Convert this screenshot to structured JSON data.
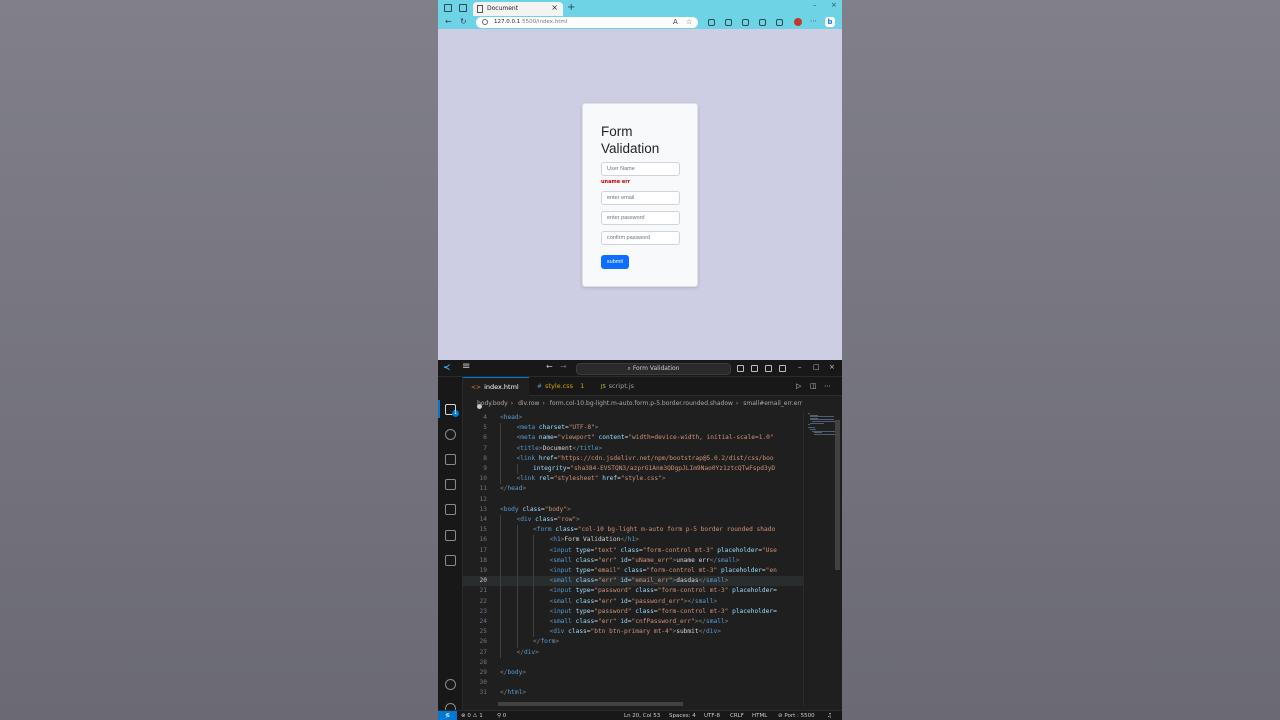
{
  "browser": {
    "tab_title": "Document",
    "url_host": "127.0.0.1",
    "url_path": ":5500/index.html",
    "form": {
      "title": "Form Validation",
      "username_placeholder": "User Name",
      "username_error": "uname err",
      "email_placeholder": "enter email",
      "password_placeholder": "enter password",
      "confirm_placeholder": "confirm password",
      "submit_label": "submit"
    },
    "colors": {
      "tabbar": "#6fd3e6",
      "page_bg": "#cdcde4",
      "button": "#0d6efd",
      "error": "#cc0000"
    }
  },
  "vscode": {
    "command_center": "Form Validation",
    "tabs": [
      {
        "label": "index.html",
        "icon": "<>",
        "modified": true
      },
      {
        "label": "style.css",
        "icon": "#",
        "problems": "1"
      },
      {
        "label": "script.js",
        "icon": "JS"
      }
    ],
    "breadcrumb": [
      "body.body",
      "div.row",
      "form.col-10.bg-light.m-auto.form.p-5.border.rounded.shadow",
      "small#email_err.err"
    ],
    "activity_badge": "1",
    "status": {
      "errors": "0",
      "warnings": "1",
      "ports": "0",
      "position": "Ln 20, Col 53",
      "spaces": "Spaces: 4",
      "encoding": "UTF-8",
      "eol": "CRLF",
      "language": "HTML",
      "port": "Port : 5500"
    },
    "current_line": 20,
    "lines": [
      {
        "n": "4",
        "indent": 0,
        "tokens": [
          [
            "p",
            "<"
          ],
          [
            "t",
            "head"
          ],
          [
            "p",
            ">"
          ]
        ]
      },
      {
        "n": "5",
        "indent": 1,
        "tokens": [
          [
            "p",
            "<"
          ],
          [
            "t",
            "meta "
          ],
          [
            "a",
            "charset"
          ],
          [
            "x",
            "="
          ],
          [
            "s",
            "\"UTF-8\""
          ],
          [
            "p",
            ">"
          ]
        ]
      },
      {
        "n": "6",
        "indent": 1,
        "tokens": [
          [
            "p",
            "<"
          ],
          [
            "t",
            "meta "
          ],
          [
            "a",
            "name"
          ],
          [
            "x",
            "="
          ],
          [
            "s",
            "\"viewport\" "
          ],
          [
            "a",
            "content"
          ],
          [
            "x",
            "="
          ],
          [
            "s",
            "\"width=device-width, initial-scale=1.0\""
          ]
        ]
      },
      {
        "n": "7",
        "indent": 1,
        "tokens": [
          [
            "p",
            "<"
          ],
          [
            "t",
            "title"
          ],
          [
            "p",
            ">"
          ],
          [
            "x",
            "Document"
          ],
          [
            "p",
            "</"
          ],
          [
            "t",
            "title"
          ],
          [
            "p",
            ">"
          ]
        ]
      },
      {
        "n": "8",
        "indent": 1,
        "tokens": [
          [
            "p",
            "<"
          ],
          [
            "t",
            "link "
          ],
          [
            "a",
            "href"
          ],
          [
            "x",
            "="
          ],
          [
            "s",
            "\"https://cdn.jsdelivr.net/npm/bootstrap@5.0.2/dist/css/boo"
          ]
        ]
      },
      {
        "n": "9",
        "indent": 2,
        "tokens": [
          [
            "a",
            "integrity"
          ],
          [
            "x",
            "="
          ],
          [
            "s",
            "\"sha384-EVSTQN3/azprG1Anm3QDgpJLIm9Nao0Yz1ztcQTwFspd3yD"
          ]
        ]
      },
      {
        "n": "10",
        "indent": 1,
        "tokens": [
          [
            "p",
            "<"
          ],
          [
            "t",
            "link "
          ],
          [
            "a",
            "rel"
          ],
          [
            "x",
            "="
          ],
          [
            "s",
            "\"stylesheet\" "
          ],
          [
            "a",
            "href"
          ],
          [
            "x",
            "="
          ],
          [
            "s",
            "\"style.css\""
          ],
          [
            "p",
            ">"
          ]
        ]
      },
      {
        "n": "11",
        "indent": 0,
        "tokens": [
          [
            "p",
            "</"
          ],
          [
            "t",
            "head"
          ],
          [
            "p",
            ">"
          ]
        ]
      },
      {
        "n": "12",
        "indent": 0,
        "tokens": []
      },
      {
        "n": "13",
        "indent": 0,
        "tokens": [
          [
            "p",
            "<"
          ],
          [
            "t",
            "body "
          ],
          [
            "a",
            "class"
          ],
          [
            "x",
            "="
          ],
          [
            "s",
            "\"body\""
          ],
          [
            "p",
            ">"
          ]
        ]
      },
      {
        "n": "14",
        "indent": 1,
        "tokens": [
          [
            "p",
            "<"
          ],
          [
            "t",
            "div "
          ],
          [
            "a",
            "class"
          ],
          [
            "x",
            "="
          ],
          [
            "s",
            "\"row\""
          ],
          [
            "p",
            ">"
          ]
        ]
      },
      {
        "n": "15",
        "indent": 2,
        "tokens": [
          [
            "p",
            "<"
          ],
          [
            "t",
            "form "
          ],
          [
            "a",
            "class"
          ],
          [
            "x",
            "="
          ],
          [
            "s",
            "\"col-10 bg-light m-auto form p-5 border rounded shado"
          ]
        ]
      },
      {
        "n": "16",
        "indent": 3,
        "tokens": [
          [
            "p",
            "<"
          ],
          [
            "t",
            "h1"
          ],
          [
            "p",
            ">"
          ],
          [
            "x",
            "Form Validation"
          ],
          [
            "p",
            "</"
          ],
          [
            "t",
            "h1"
          ],
          [
            "p",
            ">"
          ]
        ]
      },
      {
        "n": "17",
        "indent": 3,
        "tokens": [
          [
            "p",
            "<"
          ],
          [
            "t",
            "input "
          ],
          [
            "a",
            "type"
          ],
          [
            "x",
            "="
          ],
          [
            "s",
            "\"text\" "
          ],
          [
            "a",
            "class"
          ],
          [
            "x",
            "="
          ],
          [
            "s",
            "\"form-control mt-3\" "
          ],
          [
            "a",
            "placeholder"
          ],
          [
            "x",
            "="
          ],
          [
            "s",
            "\"Use"
          ]
        ]
      },
      {
        "n": "18",
        "indent": 3,
        "tokens": [
          [
            "p",
            "<"
          ],
          [
            "t",
            "small "
          ],
          [
            "a",
            "class"
          ],
          [
            "x",
            "="
          ],
          [
            "s",
            "\"err\" "
          ],
          [
            "a",
            "id"
          ],
          [
            "x",
            "="
          ],
          [
            "s",
            "\"uName_err\""
          ],
          [
            "p",
            ">"
          ],
          [
            "x",
            "uname err"
          ],
          [
            "p",
            "</"
          ],
          [
            "t",
            "small"
          ],
          [
            "p",
            ">"
          ]
        ]
      },
      {
        "n": "19",
        "indent": 3,
        "tokens": [
          [
            "p",
            "<"
          ],
          [
            "t",
            "input "
          ],
          [
            "a",
            "type"
          ],
          [
            "x",
            "="
          ],
          [
            "s",
            "\"email\" "
          ],
          [
            "a",
            "class"
          ],
          [
            "x",
            "="
          ],
          [
            "s",
            "\"form-control mt-3\" "
          ],
          [
            "a",
            "placeholder"
          ],
          [
            "x",
            "="
          ],
          [
            "s",
            "\"en"
          ]
        ]
      },
      {
        "n": "20",
        "indent": 3,
        "tokens": [
          [
            "p",
            "<"
          ],
          [
            "t",
            "small "
          ],
          [
            "a",
            "class"
          ],
          [
            "x",
            "="
          ],
          [
            "s",
            "\"err\" "
          ],
          [
            "a",
            "id"
          ],
          [
            "x",
            "="
          ],
          [
            "s",
            "\"email_err\""
          ],
          [
            "p",
            ">"
          ],
          [
            "x",
            "dasdas"
          ],
          [
            "p",
            "</"
          ],
          [
            "t",
            "small"
          ],
          [
            "p",
            ">"
          ]
        ]
      },
      {
        "n": "21",
        "indent": 3,
        "tokens": [
          [
            "p",
            "<"
          ],
          [
            "t",
            "input "
          ],
          [
            "a",
            "type"
          ],
          [
            "x",
            "="
          ],
          [
            "s",
            "\"password\" "
          ],
          [
            "a",
            "class"
          ],
          [
            "x",
            "="
          ],
          [
            "s",
            "\"form-control mt-3\" "
          ],
          [
            "a",
            "placeholder"
          ],
          [
            "x",
            "="
          ]
        ]
      },
      {
        "n": "22",
        "indent": 3,
        "tokens": [
          [
            "p",
            "<"
          ],
          [
            "t",
            "small "
          ],
          [
            "a",
            "class"
          ],
          [
            "x",
            "="
          ],
          [
            "s",
            "\"err\" "
          ],
          [
            "a",
            "id"
          ],
          [
            "x",
            "="
          ],
          [
            "s",
            "\"password_err\""
          ],
          [
            "p",
            "></"
          ],
          [
            "t",
            "small"
          ],
          [
            "p",
            ">"
          ]
        ]
      },
      {
        "n": "23",
        "indent": 3,
        "tokens": [
          [
            "p",
            "<"
          ],
          [
            "t",
            "input "
          ],
          [
            "a",
            "type"
          ],
          [
            "x",
            "="
          ],
          [
            "s",
            "\"password\" "
          ],
          [
            "a",
            "class"
          ],
          [
            "x",
            "="
          ],
          [
            "s",
            "\"form-control mt-3\" "
          ],
          [
            "a",
            "placeholder"
          ],
          [
            "x",
            "="
          ]
        ]
      },
      {
        "n": "24",
        "indent": 3,
        "tokens": [
          [
            "p",
            "<"
          ],
          [
            "t",
            "small "
          ],
          [
            "a",
            "class"
          ],
          [
            "x",
            "="
          ],
          [
            "s",
            "\"err\" "
          ],
          [
            "a",
            "id"
          ],
          [
            "x",
            "="
          ],
          [
            "s",
            "\"cnfPassword_err\""
          ],
          [
            "p",
            "></"
          ],
          [
            "t",
            "small"
          ],
          [
            "p",
            ">"
          ]
        ]
      },
      {
        "n": "25",
        "indent": 3,
        "tokens": [
          [
            "p",
            "<"
          ],
          [
            "t",
            "div "
          ],
          [
            "a",
            "class"
          ],
          [
            "x",
            "="
          ],
          [
            "s",
            "\"btn btn-primary mt-4\""
          ],
          [
            "p",
            ">"
          ],
          [
            "x",
            "submit"
          ],
          [
            "p",
            "</"
          ],
          [
            "t",
            "div"
          ],
          [
            "p",
            ">"
          ]
        ]
      },
      {
        "n": "26",
        "indent": 2,
        "tokens": [
          [
            "p",
            "</"
          ],
          [
            "t",
            "form"
          ],
          [
            "p",
            ">"
          ]
        ]
      },
      {
        "n": "27",
        "indent": 1,
        "tokens": [
          [
            "p",
            "</"
          ],
          [
            "t",
            "div"
          ],
          [
            "p",
            ">"
          ]
        ]
      },
      {
        "n": "28",
        "indent": 0,
        "tokens": []
      },
      {
        "n": "29",
        "indent": 0,
        "tokens": [
          [
            "p",
            "</"
          ],
          [
            "t",
            "body"
          ],
          [
            "p",
            ">"
          ]
        ]
      },
      {
        "n": "30",
        "indent": 0,
        "tokens": []
      },
      {
        "n": "31",
        "indent": 0,
        "tokens": [
          [
            "p",
            "</"
          ],
          [
            "t",
            "html"
          ],
          [
            "p",
            ">"
          ]
        ]
      }
    ]
  }
}
